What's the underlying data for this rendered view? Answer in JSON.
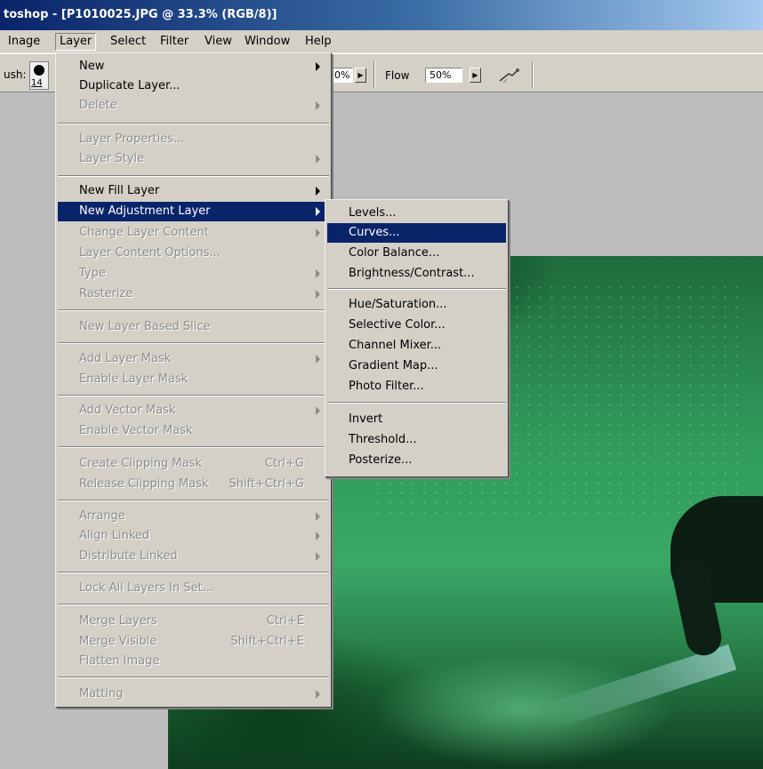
{
  "window": {
    "title": "toshop - [P1010025.JPG @ 33.3% (RGB/8)]"
  },
  "menubar": {
    "items": [
      "Inage",
      "Layer",
      "Select",
      "Filter",
      "View",
      "Window",
      "Help"
    ]
  },
  "options_bar": {
    "brush_label": "ush:",
    "brush_size": "14",
    "opacity_value": "0%",
    "flow_label": "Flow",
    "flow_value": "50%"
  },
  "layer_menu": {
    "items": [
      {
        "label": "New",
        "enabled": true,
        "submenu": true
      },
      {
        "label": "Duplicate Layer...",
        "enabled": true
      },
      {
        "label": "Delete",
        "enabled": false,
        "submenu": true
      },
      {
        "label": "Layer Properties...",
        "enabled": false
      },
      {
        "label": "Layer Style",
        "enabled": false,
        "submenu": true
      },
      {
        "label": "New Fill Layer",
        "enabled": true,
        "submenu": true
      },
      {
        "label": "New Adjustment Layer",
        "enabled": true,
        "submenu": true,
        "highlighted": true
      },
      {
        "label": "Change Layer Content",
        "enabled": false,
        "submenu": true
      },
      {
        "label": "Layer Content Options...",
        "enabled": false
      },
      {
        "label": "Type",
        "enabled": false,
        "submenu": true
      },
      {
        "label": "Rasterize",
        "enabled": false,
        "submenu": true
      },
      {
        "label": "New Layer Based Slice",
        "enabled": false
      },
      {
        "label": "Add Layer Mask",
        "enabled": false,
        "submenu": true
      },
      {
        "label": "Enable Layer Mask",
        "enabled": false
      },
      {
        "label": "Add Vector Mask",
        "enabled": false,
        "submenu": true
      },
      {
        "label": "Enable Vector Mask",
        "enabled": false
      },
      {
        "label": "Create Clipping Mask",
        "enabled": false,
        "shortcut": "Ctrl+G"
      },
      {
        "label": "Release Clipping Mask",
        "enabled": false,
        "shortcut": "Shift+Ctrl+G"
      },
      {
        "label": "Arrange",
        "enabled": false,
        "submenu": true
      },
      {
        "label": "Align Linked",
        "enabled": false,
        "submenu": true
      },
      {
        "label": "Distribute Linked",
        "enabled": false,
        "submenu": true
      },
      {
        "label": "Lock All Layers In Set...",
        "enabled": false
      },
      {
        "label": "Merge Layers",
        "enabled": false,
        "shortcut": "Ctrl+E"
      },
      {
        "label": "Merge Visible",
        "enabled": false,
        "shortcut": "Shift+Ctrl+E"
      },
      {
        "label": "Flatten Image",
        "enabled": false
      },
      {
        "label": "Matting",
        "enabled": false,
        "submenu": true
      }
    ]
  },
  "adjustment_submenu": {
    "items": [
      {
        "label": "Levels...",
        "highlighted": false
      },
      {
        "label": "Curves...",
        "highlighted": true
      },
      {
        "label": "Color Balance...",
        "highlighted": false
      },
      {
        "label": "Brightness/Contrast...",
        "highlighted": false
      },
      {
        "label": "Hue/Saturation...",
        "highlighted": false
      },
      {
        "label": "Selective Color...",
        "highlighted": false
      },
      {
        "label": "Channel Mixer...",
        "highlighted": false
      },
      {
        "label": "Gradient Map...",
        "highlighted": false
      },
      {
        "label": "Photo Filter...",
        "highlighted": false
      },
      {
        "label": "Invert",
        "highlighted": false
      },
      {
        "label": "Threshold...",
        "highlighted": false
      },
      {
        "label": "Posterize...",
        "highlighted": false
      }
    ]
  },
  "colors": {
    "highlight": "#0a246a",
    "menu_bg": "#d4d0c8",
    "disabled_text": "#8c8c8c"
  }
}
